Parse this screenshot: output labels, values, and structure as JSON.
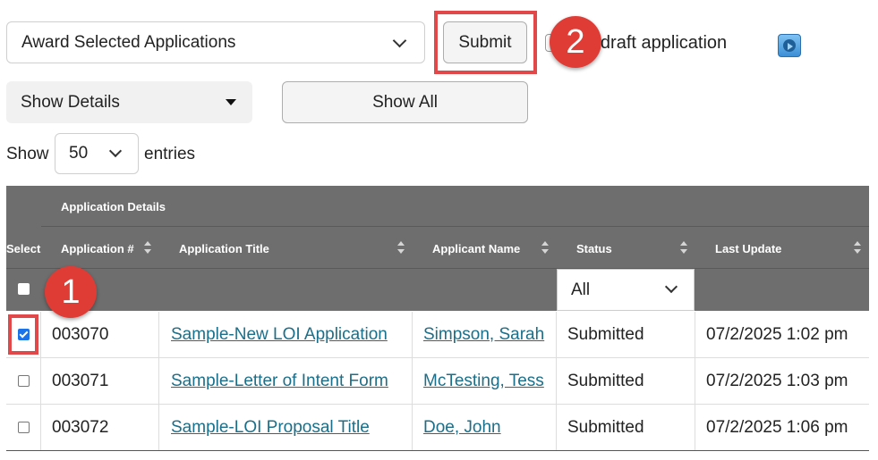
{
  "toolbar": {
    "bulk_action_value": "Award Selected Applications",
    "submit_label": "Submit",
    "draft_label": "ude draft application",
    "play_icon": "play-circle-icon"
  },
  "view": {
    "details_value": "Show Details",
    "show_all_label": "Show All"
  },
  "entries": {
    "show_label": "Show",
    "value": "50",
    "suffix": "entries"
  },
  "table": {
    "group_header": "Application Details",
    "columns": {
      "select": "Select",
      "app_num": "Application #",
      "title": "Application Title",
      "applicant": "Applicant Name",
      "status": "Status",
      "updated": "Last Update"
    },
    "status_filter": "All",
    "rows": [
      {
        "checked": true,
        "app_num": "003070",
        "title": "Sample-New LOI Application",
        "applicant": "Simpson, Sarah",
        "status": "Submitted",
        "updated": "07/2/2025 1:02 pm"
      },
      {
        "checked": false,
        "app_num": "003071",
        "title": "Sample-Letter of Intent Form",
        "applicant": "McTesting, Tess",
        "status": "Submitted",
        "updated": "07/2/2025 1:03 pm"
      },
      {
        "checked": false,
        "app_num": "003072",
        "title": "Sample-LOI Proposal Title",
        "applicant": "Doe, John",
        "status": "Submitted",
        "updated": "07/2/2025 1:06 pm"
      }
    ]
  },
  "annotations": {
    "step1": "1",
    "step2": "2",
    "highlight_color": "#e0484a"
  }
}
